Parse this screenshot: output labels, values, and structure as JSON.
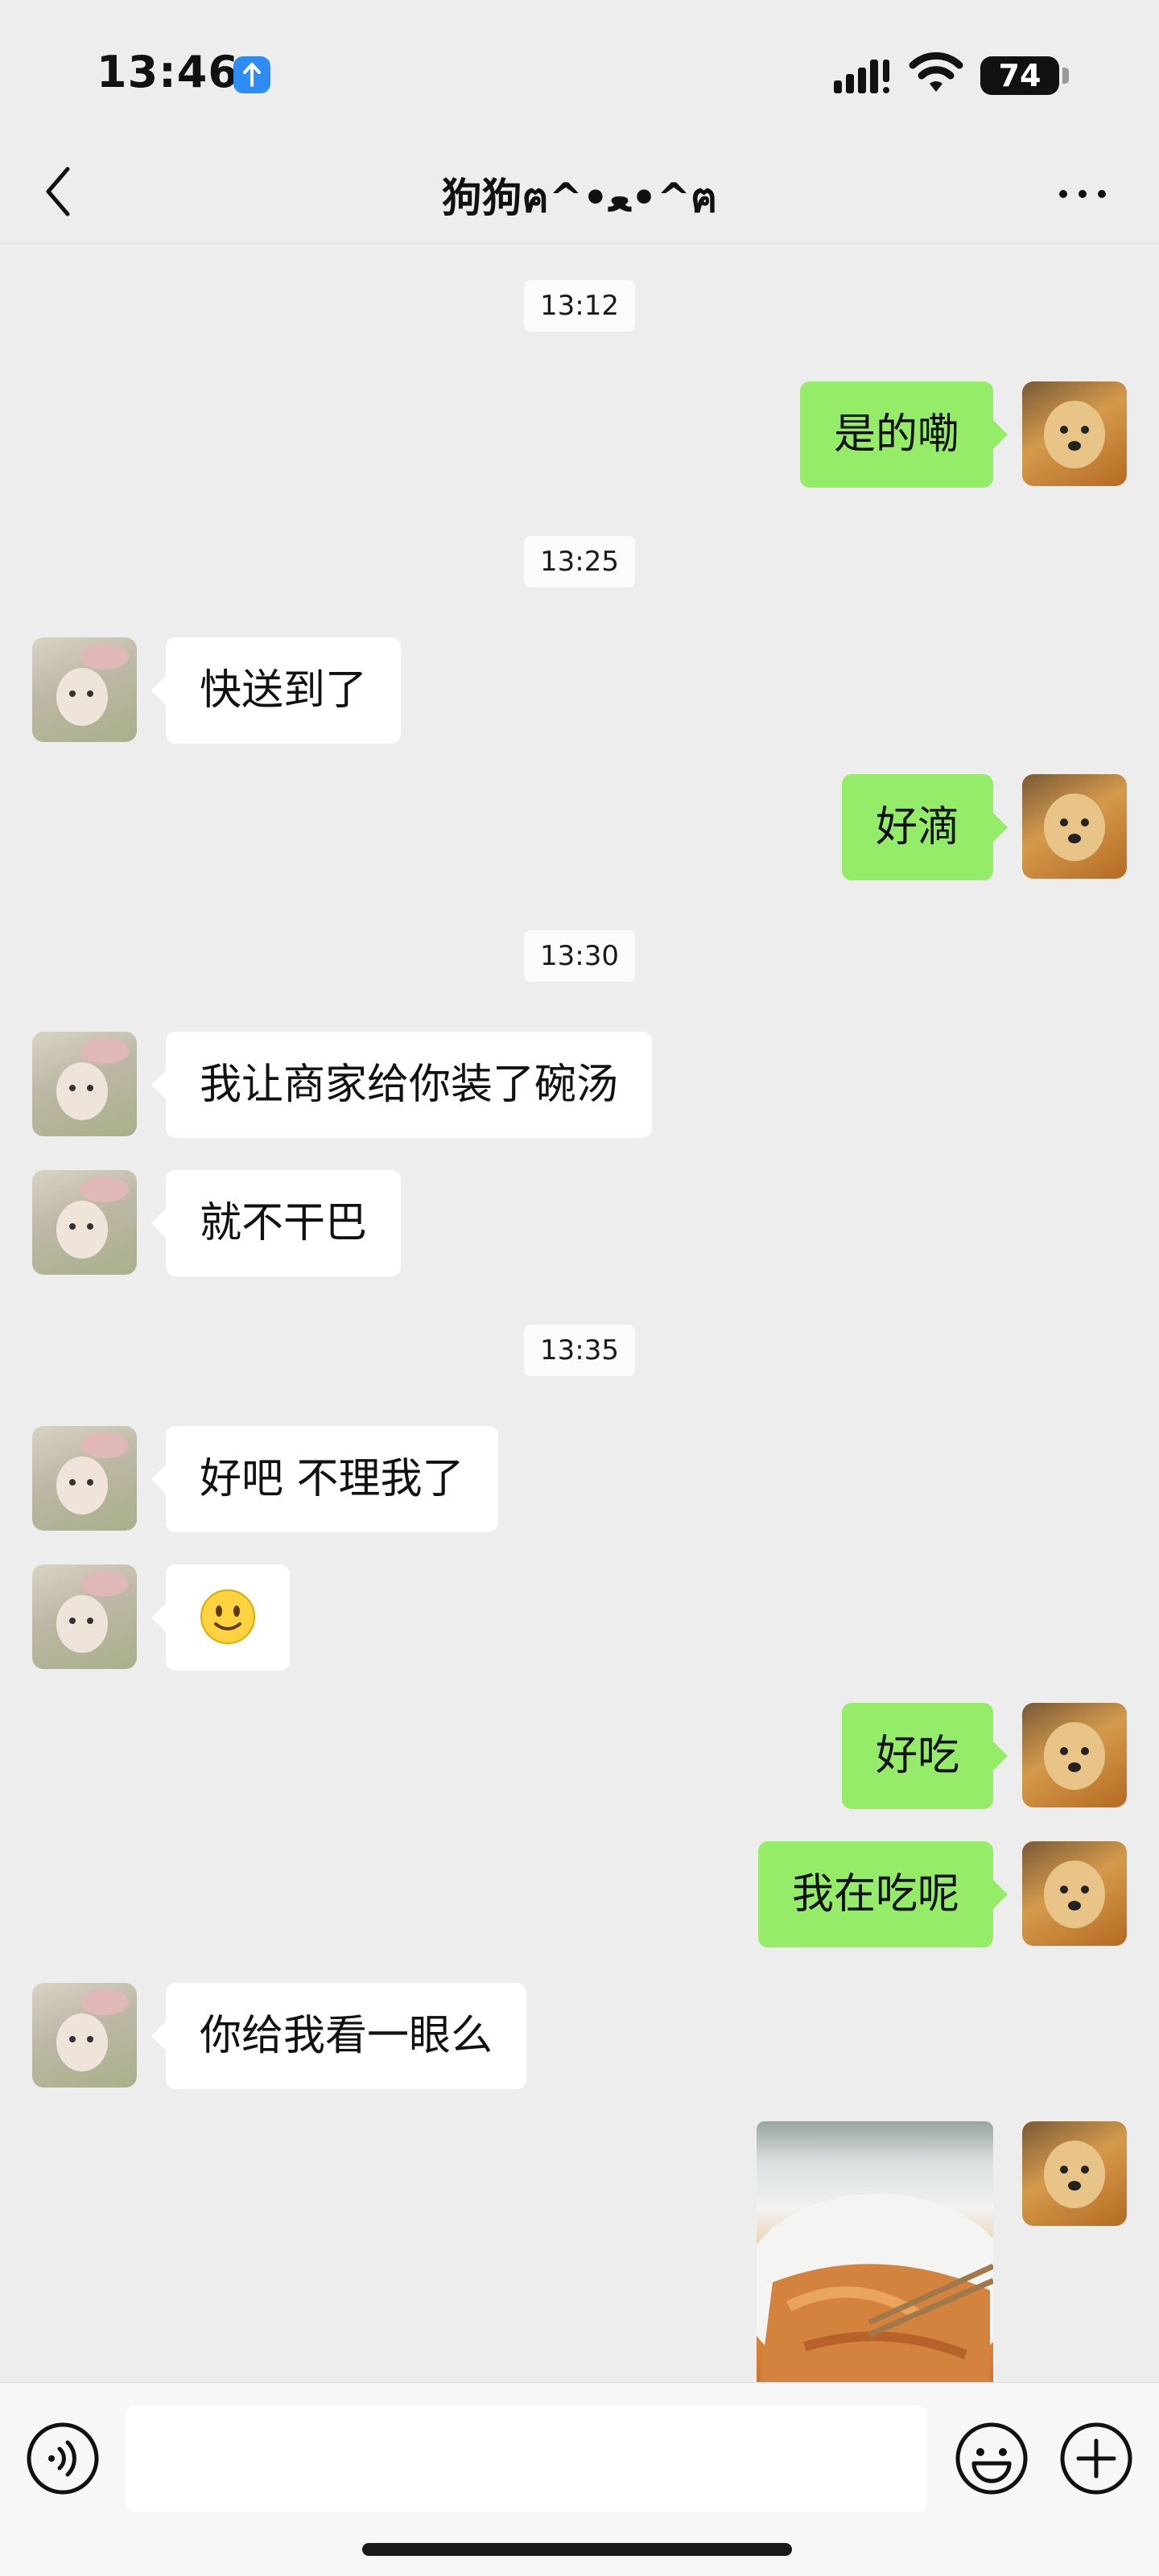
{
  "status_bar": {
    "time": "13:46",
    "battery": "74",
    "icons": [
      "location-arrow-icon",
      "cellular-signal-icon",
      "wifi-icon",
      "battery-icon"
    ]
  },
  "header": {
    "title": "狗狗ฅ^•ﻌ•^ฅ",
    "icons": [
      "chevron-left-icon",
      "more-icon"
    ]
  },
  "messages": [
    {
      "type": "time",
      "text": "13:12"
    },
    {
      "type": "text",
      "sender": "self",
      "text": "是的嘞"
    },
    {
      "type": "time",
      "text": "13:25"
    },
    {
      "type": "text",
      "sender": "friend",
      "text": "快送到了"
    },
    {
      "type": "text",
      "sender": "self",
      "text": "好滴"
    },
    {
      "type": "time",
      "text": "13:30"
    },
    {
      "type": "text",
      "sender": "friend",
      "text": "我让商家给你装了碗汤"
    },
    {
      "type": "text",
      "sender": "friend",
      "text": "就不干巴"
    },
    {
      "type": "time",
      "text": "13:35"
    },
    {
      "type": "text",
      "sender": "friend",
      "text": "好吧 不理我了"
    },
    {
      "type": "emoji",
      "sender": "friend",
      "icon": "smile-emoji-icon"
    },
    {
      "type": "text",
      "sender": "self",
      "text": "好吃"
    },
    {
      "type": "text",
      "sender": "self",
      "text": "我在吃呢"
    },
    {
      "type": "text",
      "sender": "friend",
      "text": "你给我看一眼么"
    },
    {
      "type": "image",
      "sender": "self",
      "content": "food-photo"
    }
  ],
  "input_bar": {
    "value": "",
    "placeholder": "",
    "icons": [
      "voice-icon",
      "emoji-icon",
      "plus-icon"
    ]
  },
  "colors": {
    "background": "#ededed",
    "self_bubble": "#95ec69",
    "friend_bubble": "#ffffff",
    "badge_blue": "#2f8cf5"
  }
}
